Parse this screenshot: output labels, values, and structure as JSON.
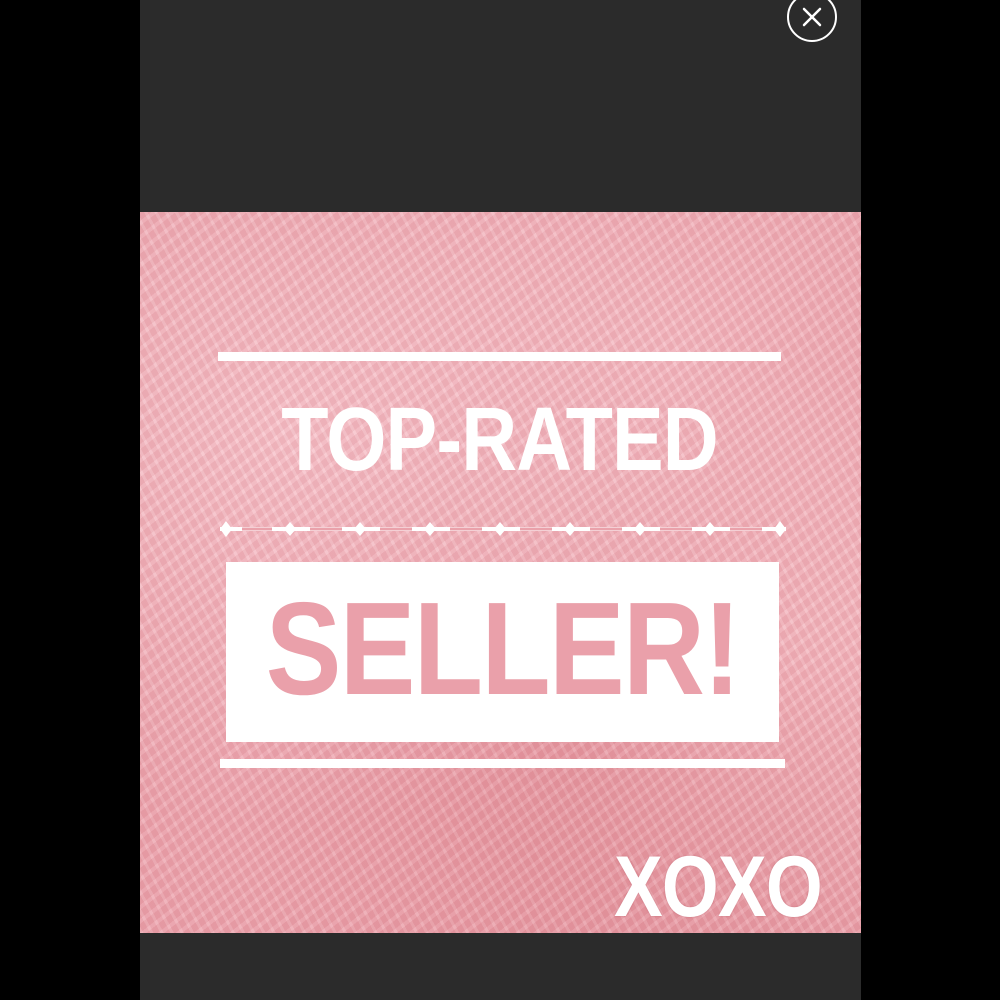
{
  "viewer": {
    "close_icon": "close-icon"
  },
  "image": {
    "headline": "TOP-RATED",
    "highlight": "SELLER!",
    "sign_off": "XOXO"
  },
  "colors": {
    "viewer_background": "#2b2b2b",
    "page_background": "#000000",
    "fur_pink": "#eaa2ab",
    "text_white": "#ffffff"
  }
}
